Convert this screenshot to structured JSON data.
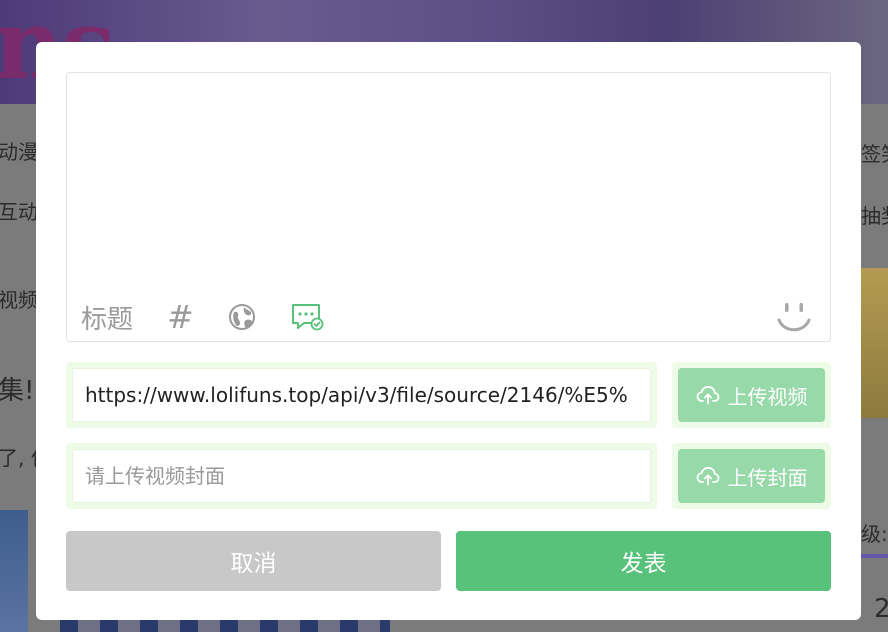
{
  "background": {
    "banner_text": "ns",
    "left_texts": [
      "动漫",
      "互动",
      "视频",
      "集!",
      "了, 什"
    ],
    "right_texts": [
      "签笑",
      "抽奖",
      "级:",
      "2"
    ]
  },
  "editor": {
    "content": "",
    "toolbar": {
      "title_label": "标题",
      "topic_label": "#",
      "globe_icon": "globe-icon",
      "chat_check_icon": "chat-check-icon",
      "emoji_icon": "smile-icon"
    }
  },
  "video": {
    "value": "https://www.lolifuns.top/api/v3/file/source/2146/%E5%",
    "upload_label": "上传视频",
    "upload_icon": "cloud-upload-icon"
  },
  "cover": {
    "placeholder": "请上传视频封面",
    "upload_label": "上传封面",
    "upload_icon": "cloud-upload-icon"
  },
  "actions": {
    "cancel_label": "取消",
    "publish_label": "发表"
  },
  "colors": {
    "primary": "#58c27a",
    "primary_light": "#97d9a8",
    "input_bg": "#eefbe6",
    "cancel": "#c8c8c8"
  }
}
